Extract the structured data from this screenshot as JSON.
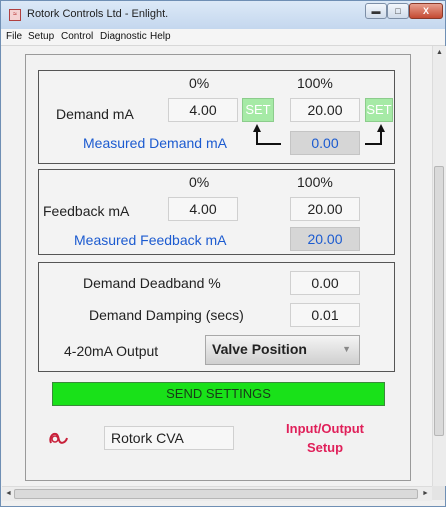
{
  "window": {
    "title": "Rotork Controls Ltd - Enlight.",
    "app_icon": "enlight-app-icon",
    "buttons": {
      "minimize": "▬",
      "maximize": "□",
      "close": "X"
    }
  },
  "menu": [
    {
      "label": "File"
    },
    {
      "label": "Setup"
    },
    {
      "label": "Control"
    },
    {
      "label": "Diagnostic"
    },
    {
      "label": "Help"
    }
  ],
  "demand": {
    "pct_low_header": "0%",
    "pct_high_header": "100%",
    "label": "Demand mA",
    "low_value": "4.00",
    "high_value": "20.00",
    "set_low_label": "SET",
    "set_high_label": "SET",
    "measured_label": "Measured Demand mA",
    "measured_value": "0.00"
  },
  "feedback": {
    "pct_low_header": "0%",
    "pct_high_header": "100%",
    "label": "Feedback mA",
    "low_value": "4.00",
    "high_value": "20.00",
    "measured_label": "Measured Feedback mA",
    "measured_value": "20.00"
  },
  "settings": {
    "deadband_label": "Demand Deadband %",
    "deadband_value": "0.00",
    "damping_label": "Demand Damping (secs)",
    "damping_value": "0.01",
    "output_label": "4-20mA Output",
    "output_selected": "Valve Position"
  },
  "send_button_label": "SEND SETTINGS",
  "footer": {
    "logo_icon": "rotork-logo-icon",
    "device_name": "Rotork CVA",
    "page_title_line1": "Input/Output",
    "page_title_line2": "Setup"
  },
  "colors": {
    "send_button": "#19e119",
    "set_button": "#a6eaa6",
    "measured_text": "#1c5bd0",
    "page_title": "#e0205a"
  }
}
